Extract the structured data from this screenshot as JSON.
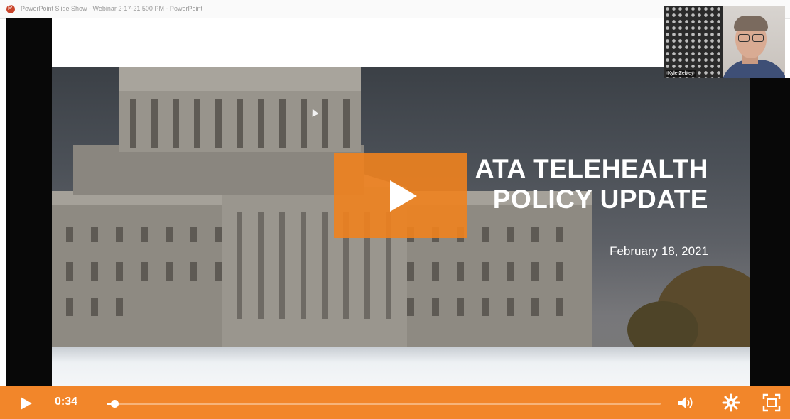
{
  "window": {
    "title": "PowerPoint Slide Show - Webinar 2-17-21 500 PM - PowerPoint"
  },
  "slide": {
    "title_lines": [
      "ATA TELEHEALTH",
      "POLICY UPDATE"
    ],
    "date": "February 18, 2021"
  },
  "webcam": {
    "name": "Kyle Zebley"
  },
  "controls": {
    "time": "0:34",
    "progress_fraction": 0.01
  },
  "icons": {
    "play": "play-icon",
    "big_play": "big-play-icon",
    "volume": "volume-icon",
    "settings": "gear-icon",
    "fullscreen": "fullscreen-icon",
    "app": "powerpoint-icon"
  },
  "colors": {
    "accent": "#f2862a",
    "big_play": "#f0821e"
  }
}
